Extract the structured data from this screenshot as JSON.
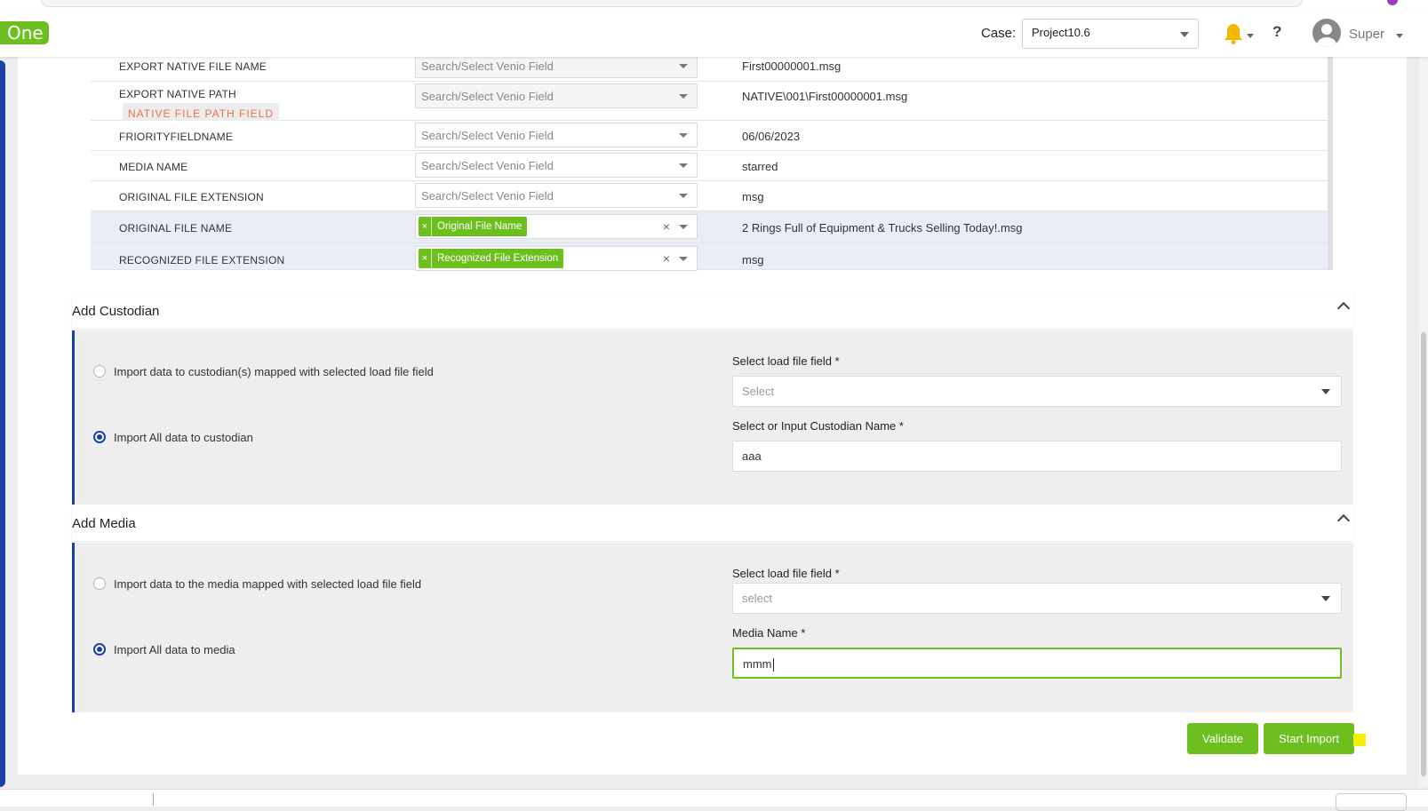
{
  "app": {
    "logo": "One"
  },
  "header": {
    "case_label": "Case:",
    "case_value": "Project10.6",
    "user_name": "Super",
    "help_glyph": "?",
    "icons": [
      "bell-icon",
      "help-icon",
      "avatar-icon"
    ]
  },
  "mapping_rows": [
    {
      "field": "EXPORT NATIVE FILE NAME",
      "warning_tag": "",
      "select_placeholder": "Search/Select Venio Field",
      "chip": "",
      "value": "First00000001.msg",
      "selected": false
    },
    {
      "field": "EXPORT NATIVE PATH",
      "warning_tag": "NATIVE FILE PATH FIELD",
      "select_placeholder": "Search/Select Venio Field",
      "chip": "",
      "value": "NATIVE\\001\\First00000001.msg",
      "selected": false
    },
    {
      "field": "FRIORITYFIELDNAME",
      "warning_tag": "",
      "select_placeholder": "Search/Select Venio Field",
      "chip": "",
      "value": "06/06/2023",
      "selected": false
    },
    {
      "field": "MEDIA NAME",
      "warning_tag": "",
      "select_placeholder": "Search/Select Venio Field",
      "chip": "",
      "value": "starred",
      "selected": false
    },
    {
      "field": "ORIGINAL FILE EXTENSION",
      "warning_tag": "",
      "select_placeholder": "Search/Select Venio Field",
      "chip": "",
      "value": "msg",
      "selected": false
    },
    {
      "field": "ORIGINAL FILE NAME",
      "warning_tag": "",
      "select_placeholder": "",
      "chip": "Original File Name",
      "value": "2 Rings Full of Equipment & Trucks Selling Today!.msg",
      "selected": true
    },
    {
      "field": "RECOGNIZED FILE EXTENSION",
      "warning_tag": "",
      "select_placeholder": "",
      "chip": "Recognized File Extension",
      "value": "msg",
      "selected": true
    }
  ],
  "custodian": {
    "title": "Add Custodian",
    "option_mapped": "Import data to custodian(s) mapped with selected load file field",
    "option_all": "Import All data to custodian",
    "load_field_label": "Select load file field *",
    "load_field_placeholder": "Select",
    "name_label": "Select or Input Custodian Name *",
    "name_value": "aaa",
    "selected_option": "all"
  },
  "media": {
    "title": "Add Media",
    "option_mapped": "Import data to the media mapped with selected load file field",
    "option_all": "Import All data to media",
    "load_field_label": "Select load file field *",
    "load_field_placeholder": "select",
    "name_label": "Media Name *",
    "name_value": "mmm",
    "selected_option": "all"
  },
  "actions": {
    "validate": "Validate",
    "start_import": "Start Import"
  },
  "colors": {
    "accent_green": "#6cbf1e",
    "accent_blue": "#1a3fa8",
    "warning_orange": "#e8734a",
    "highlight_yellow": "#f6f000"
  }
}
